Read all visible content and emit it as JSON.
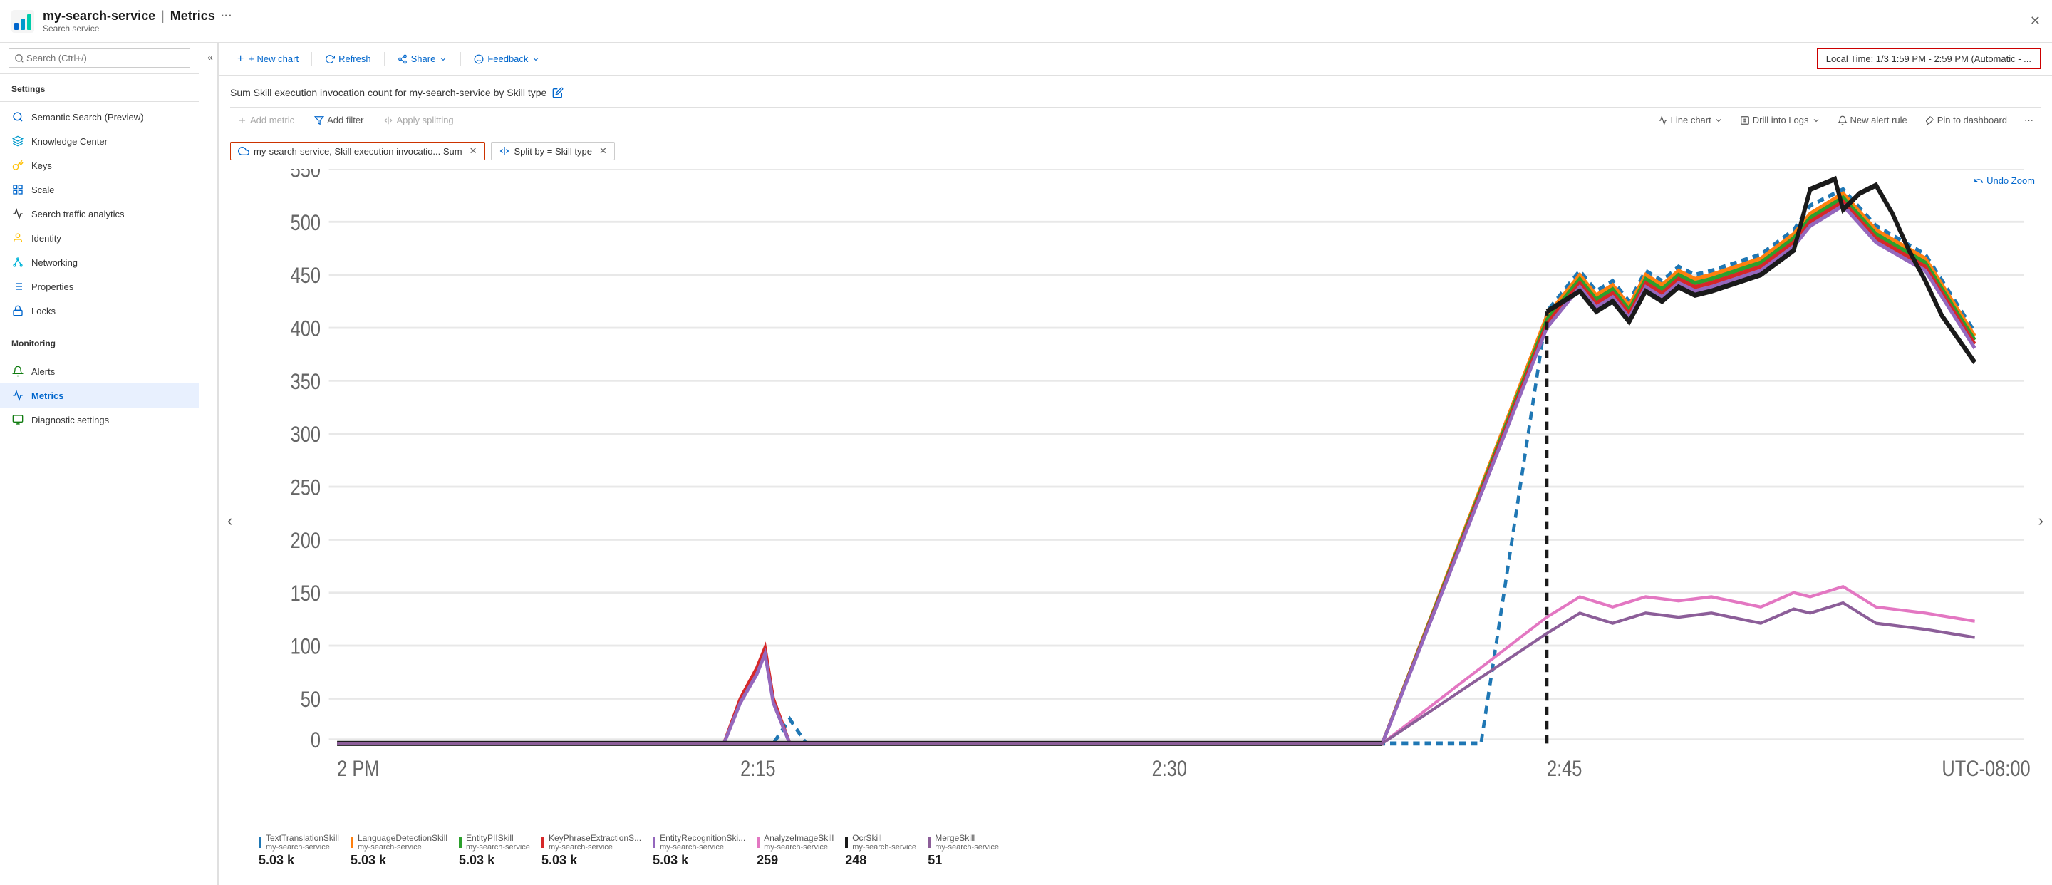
{
  "header": {
    "service_name": "my-search-service",
    "separator": "|",
    "page_title": "Metrics",
    "more_label": "···",
    "subtitle": "Search service",
    "close_label": "✕"
  },
  "search": {
    "placeholder": "Search (Ctrl+/)"
  },
  "sidebar": {
    "collapse_label": "«",
    "settings_label": "Settings",
    "monitoring_label": "Monitoring",
    "items": [
      {
        "id": "semantic-search",
        "label": "Semantic Search (Preview)",
        "icon": "search"
      },
      {
        "id": "knowledge-center",
        "label": "Knowledge Center",
        "icon": "knowledge"
      },
      {
        "id": "keys",
        "label": "Keys",
        "icon": "key"
      },
      {
        "id": "scale",
        "label": "Scale",
        "icon": "scale"
      },
      {
        "id": "search-traffic",
        "label": "Search traffic analytics",
        "icon": "chart"
      },
      {
        "id": "identity",
        "label": "Identity",
        "icon": "identity"
      },
      {
        "id": "networking",
        "label": "Networking",
        "icon": "network"
      },
      {
        "id": "properties",
        "label": "Properties",
        "icon": "properties"
      },
      {
        "id": "locks",
        "label": "Locks",
        "icon": "lock"
      },
      {
        "id": "alerts",
        "label": "Alerts",
        "icon": "alerts"
      },
      {
        "id": "metrics",
        "label": "Metrics",
        "icon": "metrics",
        "active": true
      },
      {
        "id": "diagnostic",
        "label": "Diagnostic settings",
        "icon": "diagnostic"
      }
    ]
  },
  "toolbar": {
    "new_chart_label": "+ New chart",
    "refresh_label": "Refresh",
    "share_label": "Share",
    "feedback_label": "Feedback",
    "time_range_label": "Local Time: 1/3 1:59 PM - 2:59 PM (Automatic - ..."
  },
  "chart": {
    "title": "Sum Skill execution invocation count for my-search-service by Skill type",
    "add_metric_label": "Add metric",
    "add_filter_label": "Add filter",
    "apply_splitting_label": "Apply splitting",
    "line_chart_label": "Line chart",
    "drill_into_logs_label": "Drill into Logs",
    "new_alert_rule_label": "New alert rule",
    "pin_to_dashboard_label": "Pin to dashboard",
    "more_label": "···",
    "undo_zoom_label": "Undo Zoom",
    "metric_pill": {
      "icon": "cloud",
      "label": "my-search-service, Skill execution invocatio... Sum",
      "close": "✕"
    },
    "split_pill": {
      "label": "Split by = Skill type",
      "close": "✕"
    },
    "y_axis": [
      "550",
      "500",
      "450",
      "400",
      "350",
      "300",
      "250",
      "200",
      "150",
      "100",
      "50",
      "0"
    ],
    "x_axis": [
      "2 PM",
      "2:15",
      "2:30",
      "2:45",
      "UTC-08:00"
    ]
  },
  "legend": [
    {
      "id": "text-translation",
      "label": "TextTranslationSkill",
      "sub": "my-search-service",
      "value": "5.03 k",
      "color": "#1f77b4"
    },
    {
      "id": "language-detection",
      "label": "LanguageDetectionSkill",
      "sub": "my-search-service",
      "value": "5.03 k",
      "color": "#ff7f0e"
    },
    {
      "id": "entity-pii",
      "label": "EntityPIISkill",
      "sub": "my-search-service",
      "value": "5.03 k",
      "color": "#2ca02c"
    },
    {
      "id": "key-phrase",
      "label": "KeyPhraseExtractionS...",
      "sub": "my-search-service",
      "value": "5.03 k",
      "color": "#d62728"
    },
    {
      "id": "entity-recognition",
      "label": "EntityRecognitionSki...",
      "sub": "my-search-service",
      "value": "5.03 k",
      "color": "#9467bd"
    },
    {
      "id": "analyze-image",
      "label": "AnalyzeImageSkill",
      "sub": "my-search-service",
      "value": "259",
      "color": "#e377c2"
    },
    {
      "id": "ocr",
      "label": "OcrSkill",
      "sub": "my-search-service",
      "value": "248",
      "color": "#1a1a1a"
    },
    {
      "id": "merge",
      "label": "MergeSkill",
      "sub": "my-search-service",
      "value": "51",
      "color": "#8c5e99"
    }
  ]
}
